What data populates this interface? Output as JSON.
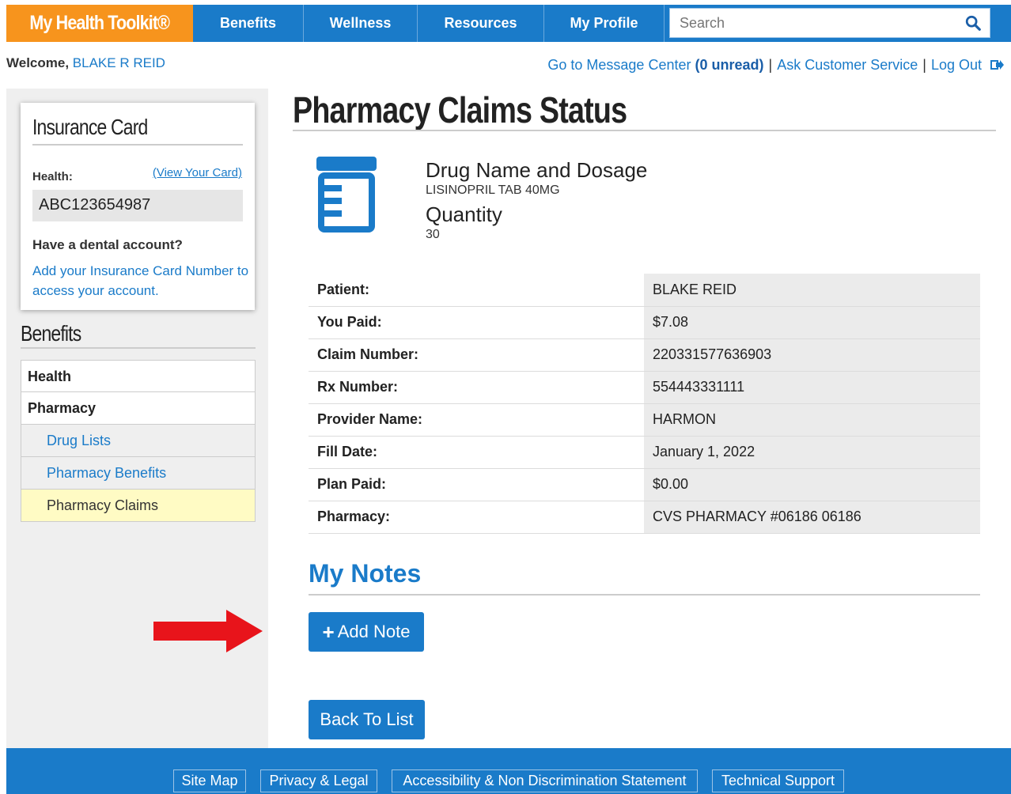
{
  "brand": {
    "name": "My Health Toolkit®"
  },
  "nav": {
    "items": [
      {
        "label": "Benefits"
      },
      {
        "label": "Wellness"
      },
      {
        "label": "Resources"
      },
      {
        "label": "My Profile"
      }
    ],
    "search_placeholder": "Search"
  },
  "header": {
    "welcome_label": "Welcome,",
    "user_name": "BLAKE R REID",
    "message_center": "Go to Message Center",
    "unread": "(0 unread)",
    "separator": "|",
    "ask_service": "Ask Customer Service",
    "logout": "Log Out"
  },
  "insurance_card": {
    "title": "Insurance Card",
    "health_label": "Health:",
    "view_card": "(View Your Card)",
    "member_id": "ABC123654987",
    "dental_question": "Have a dental account?",
    "dental_link": "Add your Insurance Card Number to access your account."
  },
  "benefits_menu": {
    "title": "Benefits",
    "items": [
      {
        "label": "Health"
      },
      {
        "label": "Pharmacy"
      },
      {
        "label": "Drug Lists"
      },
      {
        "label": "Pharmacy Benefits"
      },
      {
        "label": "Pharmacy Claims"
      }
    ]
  },
  "main": {
    "page_title": "Pharmacy Claims Status",
    "drug_label": "Drug Name and Dosage",
    "drug_value": "LISINOPRIL TAB 40MG",
    "quantity_label": "Quantity",
    "quantity_value": "30",
    "claim_rows": [
      {
        "label": "Patient:",
        "value": "BLAKE REID"
      },
      {
        "label": "You Paid:",
        "value": "$7.08"
      },
      {
        "label": "Claim Number:",
        "value": "220331577636903"
      },
      {
        "label": "Rx Number:",
        "value": "554443331111"
      },
      {
        "label": "Provider Name:",
        "value": "HARMON"
      },
      {
        "label": "Fill Date:",
        "value": "January 1, 2022"
      },
      {
        "label": "Plan Paid:",
        "value": "$0.00"
      },
      {
        "label": "Pharmacy:",
        "value": "CVS PHARMACY #06186 06186"
      }
    ],
    "notes_title": "My Notes",
    "add_note": "Add Note",
    "add_note_icon": "+",
    "back_to_list": "Back To List"
  },
  "footer": {
    "links": [
      {
        "label": "Site Map"
      },
      {
        "label": "Privacy & Legal"
      },
      {
        "label": "Accessibility & Non Discrimination Statement"
      },
      {
        "label": "Technical Support"
      }
    ]
  },
  "colors": {
    "brand_orange": "#f7941d",
    "primary_blue": "#1a7bc9",
    "active_item": "#fffbc4",
    "arrow_red": "#e8141b"
  },
  "icons": {
    "search": "search-icon",
    "logout": "logout-icon",
    "drug": "pill-bottle-icon",
    "annotation": "red-arrow-icon"
  }
}
